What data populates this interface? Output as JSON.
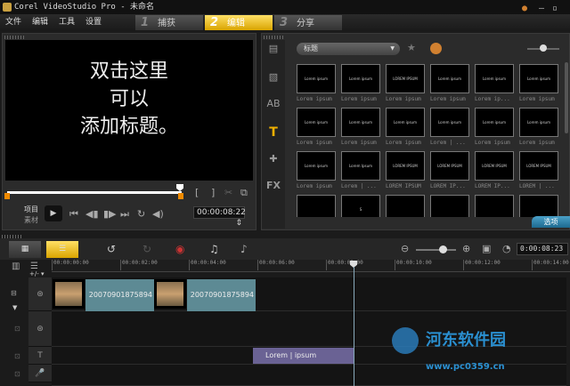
{
  "titlebar": {
    "title": "Corel VideoStudio Pro - 未命名"
  },
  "menu": [
    "文件",
    "编辑",
    "工具",
    "设置"
  ],
  "steps": [
    {
      "num": "1",
      "label": "捕获"
    },
    {
      "num": "2",
      "label": "编辑"
    },
    {
      "num": "3",
      "label": "分享"
    }
  ],
  "preview": {
    "lines": [
      "双击这里",
      "可以",
      "添加标题。"
    ]
  },
  "player": {
    "project_label": "项目",
    "clip_label": "素材",
    "timecode": "00:00:08:22",
    "mark_in": "[",
    "mark_out": "]"
  },
  "library": {
    "category": "标题",
    "options_label": "选项",
    "sidebar": [
      "media-icon",
      "transition-icon",
      "filter-icon",
      "title-icon",
      "graphic-icon",
      "fx-icon"
    ],
    "items": [
      {
        "thumb": "Lorem ipsum",
        "label": "Lorem ipsum"
      },
      {
        "thumb": "Lorem ipsum",
        "label": "Lorem ipsum"
      },
      {
        "thumb": "LOREM IPSUM",
        "label": "Lorem ipsum"
      },
      {
        "thumb": "Lorem ipsum",
        "label": "Lorem ipsum"
      },
      {
        "thumb": "Lorem ipsum",
        "label": "Lorem ip..."
      },
      {
        "thumb": "Lorem ipsum",
        "label": "Lorem ipsum"
      },
      {
        "thumb": "Lorem ipsum",
        "label": "Lorem ipsum"
      },
      {
        "thumb": "Lorem ipsum",
        "label": "Lorem ipsum"
      },
      {
        "thumb": "Lorem ipsum",
        "label": "Lorem ipsum"
      },
      {
        "thumb": "Lorem ipsum",
        "label": "Lorem | ..."
      },
      {
        "thumb": "Lorem ipsum",
        "label": "Lorem ipsum"
      },
      {
        "thumb": "Lorem ipsum",
        "label": "Lorem ipsum"
      },
      {
        "thumb": "Lorem ipsum",
        "label": "Lorem ipsum"
      },
      {
        "thumb": "Lorem Ipsum",
        "label": "Lorem | ..."
      },
      {
        "thumb": "LOREM IPSUM",
        "label": "LOREM IPSUM"
      },
      {
        "thumb": "LOREM IPSUM",
        "label": "LOREM IP..."
      },
      {
        "thumb": "LOREM IPSUM",
        "label": "LOREM IP..."
      },
      {
        "thumb": "LOREM IPSUM",
        "label": "LOREM | ..."
      },
      {
        "thumb": "",
        "label": ""
      },
      {
        "thumb": "S",
        "label": ""
      },
      {
        "thumb": "",
        "label": ""
      },
      {
        "thumb": "",
        "label": ""
      },
      {
        "thumb": "",
        "label": ""
      },
      {
        "thumb": "",
        "label": ""
      }
    ]
  },
  "timeline": {
    "timecode": "0:00:08:23",
    "zoom_controls": "+/- ▾",
    "ruler": [
      "00:00:00:00",
      "00:00:02:00",
      "00:00:04:00",
      "00:00:06:00",
      "00:00:08:00",
      "00:00:10:00",
      "00:00:12:00",
      "00:00:14:00"
    ],
    "clips": [
      "20070901875894",
      "20070901875894"
    ],
    "title_clip": "Lorem | ipsum"
  },
  "watermark": {
    "name": "河东软件园",
    "url": "www.pc0359.cn"
  }
}
